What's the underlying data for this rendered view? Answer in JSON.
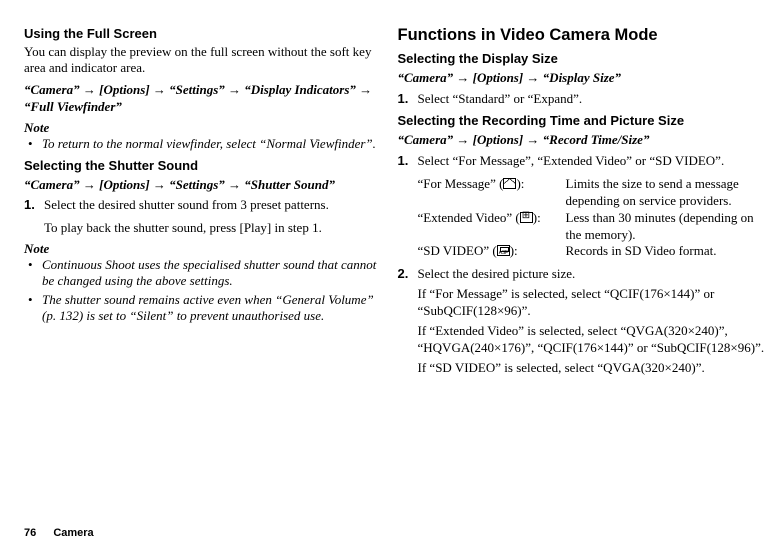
{
  "left": {
    "h1": "Using the Full Screen",
    "intro": "You can display the preview on the full screen without the soft key area and indicator area.",
    "path1": "“Camera” → [Options] → “Settings” → “Display Indicators” → “Full Viewfinder”",
    "noteLabel": "Note",
    "note1": "To return to the normal viewfinder, select “Normal Viewfinder”.",
    "h2": "Selecting the Shutter Sound",
    "path2": "“Camera” → [Options] → “Settings” → “Shutter Sound”",
    "step1": "Select the desired shutter sound from 3 preset patterns.",
    "step1b": "To play back the shutter sound, press [Play] in step 1.",
    "note2a": "Continuous Shoot uses the specialised shutter sound that cannot be changed using the above settings.",
    "note2b": "The shutter sound remains active even when “General Volume” (p. 132) is set to “Silent” to prevent unauthorised use."
  },
  "right": {
    "hbig": "Functions in Video Camera Mode",
    "h1": "Selecting the Display Size",
    "path1": "“Camera” → [Options] → “Display Size”",
    "step1": "Select “Standard” or “Expand”.",
    "h2": "Selecting the Recording Time and Picture Size",
    "path2": "“Camera” → [Options] → “Record Time/Size”",
    "step2_1": "Select “For Message”, “Extended Video” or “SD VIDEO”.",
    "def1label": "“For Message” (",
    "def1labelEnd": "):",
    "def1val": "Limits the size to send a message depending on service providers.",
    "def2label": "“Extended Video” (",
    "def2labelEnd": "):",
    "def2val": "Less than 30 minutes (depending on the memory).",
    "def3label": "“SD VIDEO” (",
    "def3labelEnd": "):",
    "def3val": "Records in SD Video format.",
    "step2_2": "Select the desired picture size.",
    "step2_2a": "If “For Message” is selected, select “QCIF(176×144)” or “SubQCIF(128×96)”.",
    "step2_2b": "If “Extended Video” is selected, select “QVGA(320×240)”, “HQVGA(240×176)”, “QCIF(176×144)” or “SubQCIF(128×96)”.",
    "step2_2c": "If “SD VIDEO” is selected, select “QVGA(320×240)”.",
    "num1": "1.",
    "num2": "2."
  },
  "footer": {
    "page": "76",
    "section": "Camera"
  }
}
